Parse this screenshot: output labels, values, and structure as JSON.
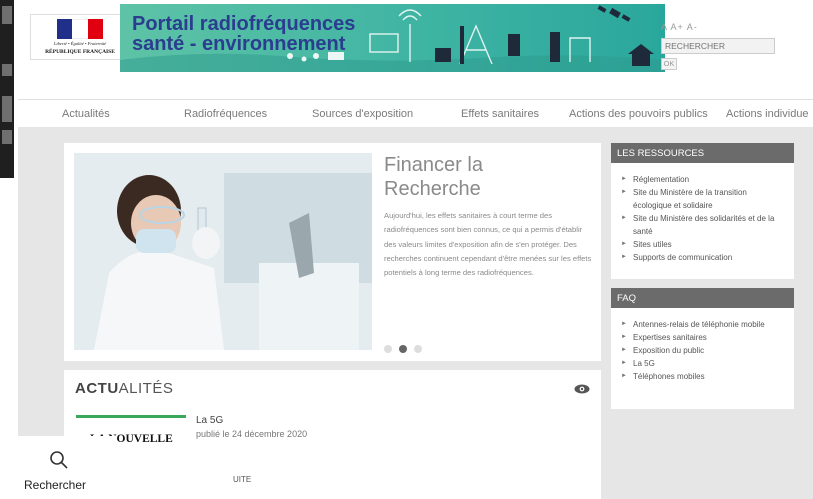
{
  "header": {
    "flag_colors": [
      "#1f2f8a",
      "#ffffff",
      "#e1000f"
    ],
    "marianne_motto": "Liberté • Égalité • Fraternité",
    "marianne_republic": "RÉPUBLIQUE FRANÇAISE",
    "title_line1": "Portail radiofréquences",
    "title_line2": "santé - environnement",
    "font_tools": "A  A+  A-",
    "search_placeholder": "RECHERCHER",
    "ok_label": "OK"
  },
  "nav": {
    "items": [
      "Actualités",
      "Radiofréquences",
      "Sources d'exposition",
      "Effets sanitaires",
      "Actions des pouvoirs publics",
      "Actions individue"
    ]
  },
  "slider": {
    "title": "Financer la Recherche",
    "text": "Aujourd'hui, les effets sanitaires à court terme des radiofréquences sont bien connus, ce qui a permis d'établir des valeurs limites d'exposition afin de s'en protéger. Des recherches continuent cependant d'être menées sur les effets potentiels à long terme des radiofréquences.",
    "active_slide": 2,
    "slide_count": 3
  },
  "news": {
    "heading_bold": "ACTU",
    "heading_rest": "ALITÉS",
    "thumb_label": "LA NOUVELLE",
    "item_title": "La 5G",
    "item_date": "publié le 24 décembre 2020",
    "suite_label": "UITE"
  },
  "ressources": {
    "title": "LES RESSOURCES",
    "items": [
      "Réglementation",
      "Site du Ministère de la transition écologique et solidaire",
      "Site du Ministère des solidarités et de la santé",
      "Sites utiles",
      "Supports de communication"
    ]
  },
  "faq": {
    "title": "FAQ",
    "items": [
      "Antennes-relais de téléphonie mobile",
      "Expertises sanitaires",
      "Exposition du public",
      "La 5G",
      "Téléphones mobiles"
    ]
  },
  "search_popup": {
    "label": "Rechercher",
    "icon": "search-icon"
  },
  "colors": {
    "banner": "#3fb4a3",
    "banner_title": "#2b3d8f",
    "panel_header": "#6b6b6b",
    "news_accent": "#3aa85a"
  }
}
